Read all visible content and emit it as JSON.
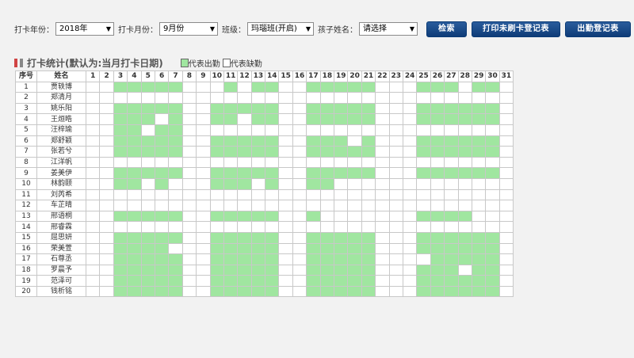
{
  "filters": {
    "year_label": "打卡年份：",
    "year_value": "2018年",
    "month_label": "打卡月份：",
    "month_value": "9月份",
    "class_label": "班级：",
    "class_value": "玛瑙班(开启)",
    "child_label": "孩子姓名：",
    "child_value": "请选择",
    "dropdown_icon": "caret-down-icon"
  },
  "buttons": {
    "search": "检索",
    "print_unpunched": "打印未刷卡登记表",
    "attendance_register": "出勤登记表"
  },
  "section": {
    "title": "打卡统计(默认为:当月打卡日期)",
    "legend_present": "代表出勤",
    "legend_absent": "代表缺勤",
    "present_color": "#a0e6a0",
    "absent_color": "#ffffff"
  },
  "table": {
    "headers": {
      "index": "序号",
      "name": "姓名"
    },
    "days": [
      "1",
      "2",
      "3",
      "4",
      "5",
      "6",
      "7",
      "8",
      "9",
      "10",
      "11",
      "12",
      "13",
      "14",
      "15",
      "16",
      "17",
      "18",
      "19",
      "20",
      "21",
      "22",
      "23",
      "24",
      "25",
      "26",
      "27",
      "28",
      "29",
      "30",
      "31"
    ],
    "rows": [
      {
        "index": "1",
        "name": "贾轶博",
        "present": [
          3,
          4,
          5,
          6,
          7,
          11,
          13,
          14,
          17,
          18,
          19,
          20,
          21,
          25,
          26,
          27,
          29,
          30
        ]
      },
      {
        "index": "2",
        "name": "郑清月",
        "present": []
      },
      {
        "index": "3",
        "name": "姚乐阳",
        "present": [
          3,
          4,
          5,
          6,
          7,
          10,
          11,
          12,
          13,
          14,
          17,
          18,
          19,
          20,
          21,
          25,
          26,
          27,
          28,
          29,
          30
        ]
      },
      {
        "index": "4",
        "name": "王烜晧",
        "present": [
          3,
          4,
          5,
          7,
          10,
          11,
          13,
          14,
          17,
          18,
          19,
          20,
          21,
          25,
          26,
          27,
          28,
          29,
          30
        ]
      },
      {
        "index": "5",
        "name": "汪梓瑜",
        "present": [
          3,
          4,
          6,
          7
        ]
      },
      {
        "index": "6",
        "name": "郑舒颖",
        "present": [
          3,
          4,
          5,
          6,
          7,
          10,
          11,
          12,
          13,
          14,
          17,
          18,
          19,
          21,
          25,
          26,
          27,
          28,
          29,
          30
        ]
      },
      {
        "index": "7",
        "name": "张若兮",
        "present": [
          3,
          4,
          5,
          6,
          7,
          10,
          11,
          12,
          13,
          14,
          17,
          18,
          19,
          20,
          21,
          25,
          26,
          27,
          28,
          29,
          30
        ]
      },
      {
        "index": "8",
        "name": "江洋帆",
        "present": []
      },
      {
        "index": "9",
        "name": "姜美伊",
        "present": [
          3,
          4,
          5,
          6,
          7,
          10,
          11,
          12,
          13,
          14,
          17,
          18,
          19,
          20,
          21,
          25,
          26,
          27,
          28,
          29,
          30
        ]
      },
      {
        "index": "10",
        "name": "林韵颐",
        "present": [
          3,
          4,
          6,
          10,
          11,
          12,
          14,
          17,
          18
        ]
      },
      {
        "index": "11",
        "name": "刘芮希",
        "present": []
      },
      {
        "index": "12",
        "name": "车芷晴",
        "present": []
      },
      {
        "index": "13",
        "name": "邢语桐",
        "present": [
          3,
          4,
          5,
          6,
          7,
          10,
          11,
          12,
          13,
          14,
          17,
          25,
          26,
          27,
          28
        ]
      },
      {
        "index": "14",
        "name": "邢睿霖",
        "present": []
      },
      {
        "index": "15",
        "name": "屈思妍",
        "present": [
          3,
          4,
          5,
          6,
          7,
          10,
          11,
          12,
          13,
          14,
          17,
          18,
          19,
          20,
          21,
          25,
          26,
          27,
          28,
          29,
          30
        ]
      },
      {
        "index": "16",
        "name": "荣美萱",
        "present": [
          3,
          4,
          5,
          6,
          10,
          11,
          12,
          13,
          14,
          17,
          18,
          19,
          20,
          21,
          25,
          26,
          27,
          28,
          29,
          30
        ]
      },
      {
        "index": "17",
        "name": "石尊丞",
        "present": [
          3,
          4,
          5,
          6,
          7,
          10,
          11,
          12,
          13,
          14,
          17,
          18,
          19,
          20,
          21,
          26,
          27,
          28,
          29,
          30
        ]
      },
      {
        "index": "18",
        "name": "罗晨予",
        "present": [
          3,
          4,
          5,
          6,
          7,
          10,
          11,
          12,
          13,
          14,
          17,
          18,
          19,
          20,
          21,
          25,
          26,
          27,
          29,
          30
        ]
      },
      {
        "index": "19",
        "name": "范泽可",
        "present": [
          3,
          4,
          5,
          6,
          7,
          10,
          11,
          12,
          13,
          14,
          17,
          18,
          19,
          20,
          21,
          25,
          26,
          27,
          28,
          29,
          30
        ]
      },
      {
        "index": "20",
        "name": "钱析铭",
        "present": [
          3,
          4,
          5,
          6,
          7,
          10,
          11,
          12,
          13,
          14,
          17,
          18,
          19,
          20,
          21,
          25,
          26,
          27,
          28,
          29,
          30
        ]
      }
    ]
  }
}
